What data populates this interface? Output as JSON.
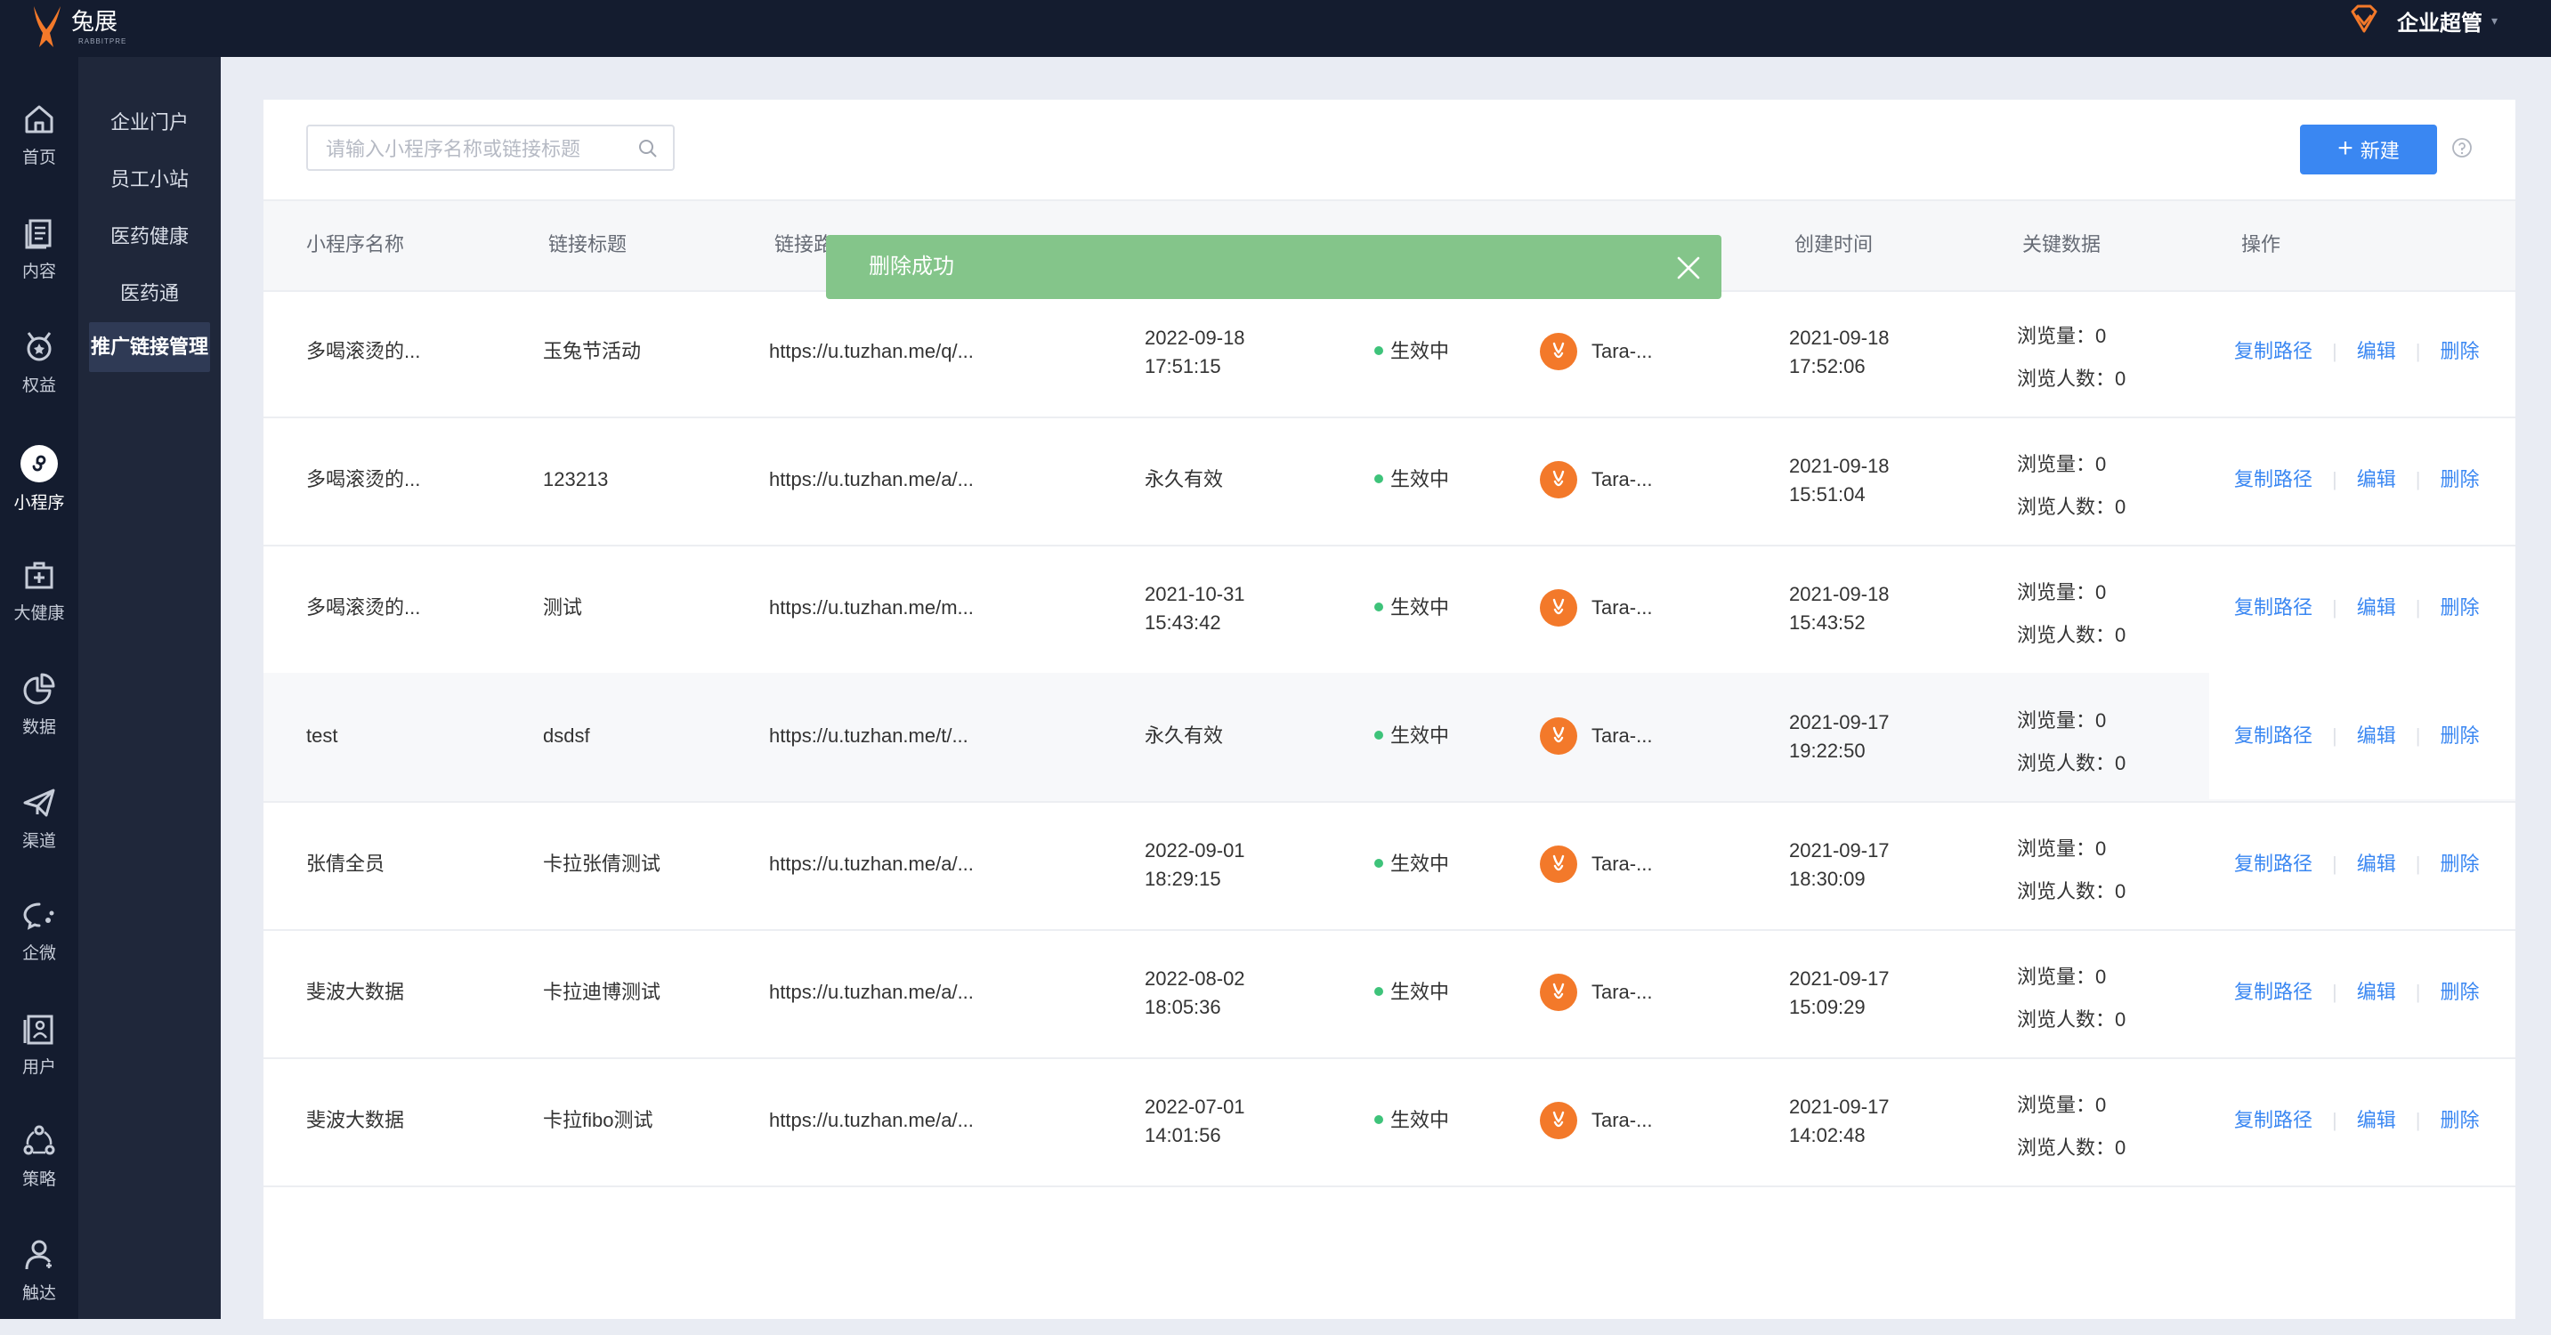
{
  "brand": {
    "name": "兔展",
    "sub": "RABBITPRE"
  },
  "user": {
    "name": "企业超管"
  },
  "rail": [
    {
      "label": "首页",
      "icon": "home-icon"
    },
    {
      "label": "内容",
      "icon": "document-icon"
    },
    {
      "label": "权益",
      "icon": "medal-icon"
    },
    {
      "label": "小程序",
      "icon": "mini-program-icon"
    },
    {
      "label": "大健康",
      "icon": "health-kit-icon"
    },
    {
      "label": "数据",
      "icon": "pie-chart-icon"
    },
    {
      "label": "渠道",
      "icon": "paper-plane-icon"
    },
    {
      "label": "企微",
      "icon": "chat-bubble-icon"
    },
    {
      "label": "用户",
      "icon": "user-list-icon"
    },
    {
      "label": "策略",
      "icon": "strategy-icon"
    },
    {
      "label": "触达",
      "icon": "person-icon"
    }
  ],
  "subnav": [
    {
      "label": "企业门户"
    },
    {
      "label": "员工小站"
    },
    {
      "label": "医药健康"
    },
    {
      "label": "医药通"
    },
    {
      "label": "推广链接管理"
    }
  ],
  "search": {
    "placeholder": "请输入小程序名称或链接标题"
  },
  "new_button": "新建",
  "columns": {
    "name": "小程序名称",
    "title": "链接标题",
    "path": "链接路",
    "created": "创建时间",
    "metrics": "关键数据",
    "ops": "操作"
  },
  "rows": [
    {
      "name": "多喝滚烫的...",
      "title": "玉兔节活动",
      "url": "https://u.tuzhan.me/q/...",
      "expire_date": "2022-09-18",
      "expire_time": "17:51:15",
      "status": "生效中",
      "creator": "Tara-...",
      "created_date": "2021-09-18",
      "created_time": "17:52:06",
      "pv": "浏览量：0",
      "uv": "浏览人数：0"
    },
    {
      "name": "多喝滚烫的...",
      "title": "123213",
      "url": "https://u.tuzhan.me/a/...",
      "expire_single": "永久有效",
      "status": "生效中",
      "creator": "Tara-...",
      "created_date": "2021-09-18",
      "created_time": "15:51:04",
      "pv": "浏览量：0",
      "uv": "浏览人数：0"
    },
    {
      "name": "多喝滚烫的...",
      "title": "测试",
      "url": "https://u.tuzhan.me/m...",
      "expire_date": "2021-10-31",
      "expire_time": "15:43:42",
      "status": "生效中",
      "creator": "Tara-...",
      "created_date": "2021-09-18",
      "created_time": "15:43:52",
      "pv": "浏览量：0",
      "uv": "浏览人数：0"
    },
    {
      "name": "test",
      "title": "dsdsf",
      "url": "https://u.tuzhan.me/t/...",
      "expire_single": "永久有效",
      "status": "生效中",
      "creator": "Tara-...",
      "created_date": "2021-09-17",
      "created_time": "19:22:50",
      "pv": "浏览量：0",
      "uv": "浏览人数：0"
    },
    {
      "name": "张倩全员",
      "title": "卡拉张倩测试",
      "url": "https://u.tuzhan.me/a/...",
      "expire_date": "2022-09-01",
      "expire_time": "18:29:15",
      "status": "生效中",
      "creator": "Tara-...",
      "created_date": "2021-09-17",
      "created_time": "18:30:09",
      "pv": "浏览量：0",
      "uv": "浏览人数：0"
    },
    {
      "name": "斐波大数据",
      "title": "卡拉迪博测试",
      "url": "https://u.tuzhan.me/a/...",
      "expire_date": "2022-08-02",
      "expire_time": "18:05:36",
      "status": "生效中",
      "creator": "Tara-...",
      "created_date": "2021-09-17",
      "created_time": "15:09:29",
      "pv": "浏览量：0",
      "uv": "浏览人数：0"
    },
    {
      "name": "斐波大数据",
      "title": "卡拉fibo测试",
      "url": "https://u.tuzhan.me/a/...",
      "expire_date": "2022-07-01",
      "expire_time": "14:01:56",
      "status": "生效中",
      "creator": "Tara-...",
      "created_date": "2021-09-17",
      "created_time": "14:02:48",
      "pv": "浏览量：0",
      "uv": "浏览人数：0"
    }
  ],
  "ops": {
    "copy": "复制路径",
    "edit": "编辑",
    "delete": "删除"
  },
  "toast": {
    "message": "删除成功"
  },
  "colors": {
    "primary": "#3a87f2",
    "nav_bg": "#141c2f",
    "subnav_bg": "#1f273a",
    "toast_bg": "#84c58a",
    "status_green": "#3ec37a",
    "avatar_orange": "#f3792a"
  }
}
